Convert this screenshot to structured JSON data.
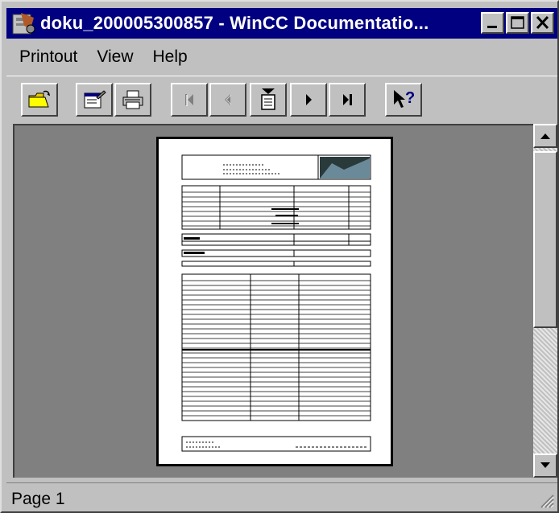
{
  "window": {
    "title": "doku_200005300857 - WinCC Documentatio..."
  },
  "menu": [
    {
      "label": "Printout"
    },
    {
      "label": "View"
    },
    {
      "label": "Help"
    }
  ],
  "toolbar": {
    "buttons": [
      {
        "name": "open-icon"
      },
      {
        "name": "properties-icon"
      },
      {
        "name": "print-icon"
      },
      {
        "name": "first-page-icon",
        "enabled": false
      },
      {
        "name": "previous-page-icon",
        "enabled": false
      },
      {
        "name": "single-page-icon"
      },
      {
        "name": "next-page-icon"
      },
      {
        "name": "last-page-icon"
      },
      {
        "name": "context-help-icon"
      }
    ]
  },
  "status": {
    "page_text": "Page 1"
  },
  "colors": {
    "titlebar": "#000080",
    "face": "#c0c0c0",
    "viewport": "#808080"
  }
}
